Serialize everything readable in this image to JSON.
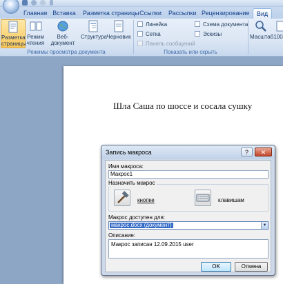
{
  "tabs": [
    "Главная",
    "Вставка",
    "Разметка страницы",
    "Ссылки",
    "Рассылки",
    "Рецензирование",
    "Вид"
  ],
  "active_tab": "Вид",
  "ribbon": {
    "views_group": {
      "label": "Режимы просмотра документа",
      "buttons": [
        {
          "line1": "Разметка",
          "line2": "страницы"
        },
        {
          "line1": "Режим",
          "line2": "чтения"
        },
        {
          "line1": "Веб-документ",
          "line2": ""
        },
        {
          "line1": "Структура",
          "line2": ""
        },
        {
          "line1": "Черновик",
          "line2": ""
        }
      ]
    },
    "show_group": {
      "label": "Показать или скрыть",
      "checks": [
        "Линейка",
        "Сетка",
        "Панель сообщений",
        "Схема документа",
        "Эскизы"
      ]
    },
    "zoom_group": {
      "buttons": [
        "Масштаб",
        "100"
      ]
    }
  },
  "document": {
    "text": "Шла Саша по шоссе и сосала сушку"
  },
  "dialog": {
    "title": "Запись макроса",
    "help": "?",
    "close": "✕",
    "macro_name_label": "Имя макроса:",
    "macro_name_value": "Макрос1",
    "assign_label": "Назначить макрос",
    "assign_button_label": "кнопке",
    "assign_keyboard_label": "клавишам",
    "store_label": "Макрос доступен для:",
    "store_value": "макрос.docx (документ)",
    "description_label": "Описание:",
    "description_value": "Макрос записан 12.09.2015 user",
    "ok": "OK",
    "cancel": "Отмена"
  },
  "colors": {
    "accent": "#15428b",
    "selection": "#3169c6"
  }
}
